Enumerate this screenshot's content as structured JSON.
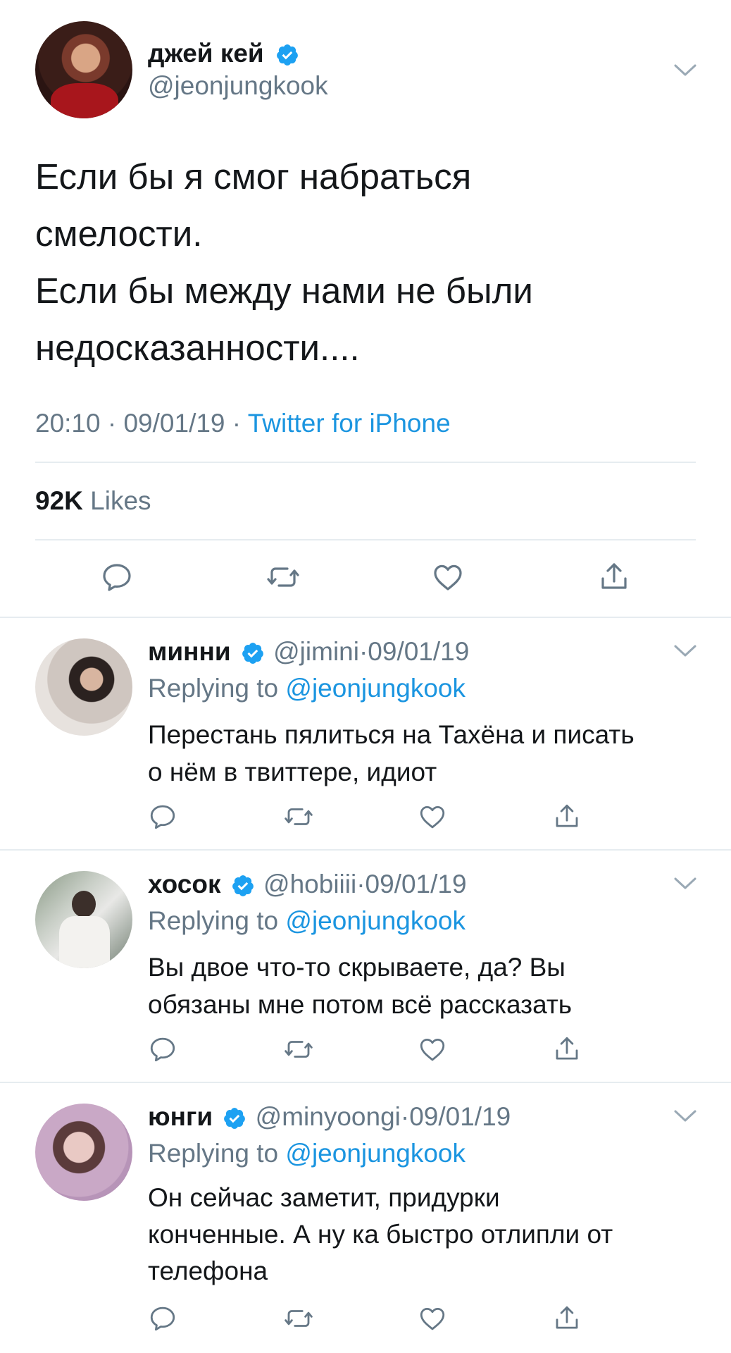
{
  "main_tweet": {
    "display_name": "джей кей",
    "handle": "@jeonjungkook",
    "text_lines": [
      "Если бы я смог набраться",
      "смелости.",
      "Если бы между нами не были",
      "недосказанности...."
    ],
    "time": "20:10",
    "date": "09/01/19",
    "separator": "·",
    "source": "Twitter for iPhone",
    "likes_count": "92K",
    "likes_label": "Likes"
  },
  "replies": [
    {
      "display_name": "минни",
      "handle": "@jimini",
      "date": "09/01/19",
      "replying_prefix": "Replying to",
      "replying_to": "@jeonjungkook",
      "text_lines": [
        "Перестань пялиться на Тахёна и писать",
        "о нём в твиттере, идиот"
      ]
    },
    {
      "display_name": "хосок",
      "handle": "@hobiiii",
      "date": "09/01/19",
      "replying_prefix": "Replying to",
      "replying_to": "@jeonjungkook",
      "text_lines": [
        "Вы двое что-то скрываете, да? Вы",
        "обязаны мне потом всё рассказать"
      ]
    },
    {
      "display_name": "юнги",
      "handle": "@minyoongi",
      "date": "09/01/19",
      "replying_prefix": "Replying to",
      "replying_to": "@jeonjungkook",
      "text_lines": [
        "Он сейчас заметит, придурки",
        "конченные. А ну ка быстро отлипли от",
        "телефона"
      ]
    }
  ],
  "icons": {
    "verified": "verified-badge-icon",
    "chevron": "chevron-down-icon",
    "reply": "reply-icon",
    "retweet": "retweet-icon",
    "like": "heart-icon",
    "share": "share-icon"
  },
  "colors": {
    "accent": "#1b95e0",
    "secondary_text": "#657786",
    "divider": "#e6ecf0"
  }
}
